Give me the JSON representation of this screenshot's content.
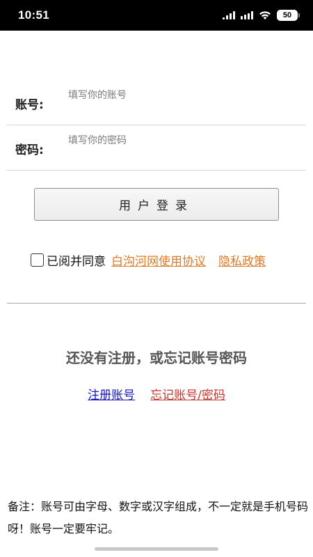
{
  "status_bar": {
    "time": "10:51",
    "battery": "50"
  },
  "form": {
    "account_label": "账号:",
    "account_placeholder": "填写你的账号",
    "password_label": "密码:",
    "password_placeholder": "填写你的密码"
  },
  "login_button": "用户登录",
  "agreement": {
    "text": "已阅并同意",
    "terms_link": "白沟河网使用协议",
    "privacy_link": "隐私政策"
  },
  "prompt": "还没有注册，或忘记账号密码",
  "links": {
    "register": "注册账号",
    "forgot": "忘记账号/密码"
  },
  "note": "备注：账号可由字母、数字或汉字组成，不一定就是手机号码呀！账号一定要牢记。"
}
